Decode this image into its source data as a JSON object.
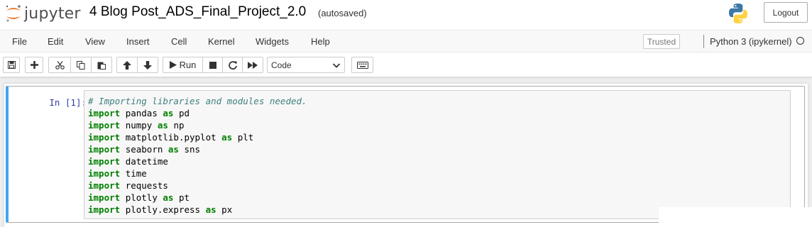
{
  "header": {
    "logo_text": "jupyter",
    "notebook_name": "4 Blog Post_ADS_Final_Project_2.0",
    "autosave_status": "(autosaved)",
    "logout_label": "Logout"
  },
  "menubar": {
    "items": [
      "File",
      "Edit",
      "View",
      "Insert",
      "Cell",
      "Kernel",
      "Widgets",
      "Help"
    ],
    "trusted_label": "Trusted",
    "kernel_name": "Python 3 (ipykernel)"
  },
  "toolbar": {
    "run_label": "Run",
    "cell_type": "Code",
    "icons": [
      "save-icon",
      "plus-icon",
      "cut-icon",
      "copy-icon",
      "paste-icon",
      "arrow-up-icon",
      "arrow-down-icon",
      "play-icon",
      "stop-icon",
      "restart-icon",
      "fast-forward-icon",
      "keyboard-icon"
    ]
  },
  "cell": {
    "prompt": "In [1]:",
    "comment": "# Importing libraries and modules needed.",
    "lines": [
      {
        "kw": "import",
        "mod": "pandas",
        "as": "as",
        "alias": "pd"
      },
      {
        "kw": "import",
        "mod": "numpy",
        "as": "as",
        "alias": "np"
      },
      {
        "kw": "import",
        "mod": "matplotlib.pyplot",
        "as": "as",
        "alias": "plt"
      },
      {
        "kw": "import",
        "mod": "seaborn",
        "as": "as",
        "alias": "sns"
      },
      {
        "kw": "import",
        "mod": "datetime"
      },
      {
        "kw": "import",
        "mod": "time"
      },
      {
        "kw": "import",
        "mod": "requests"
      },
      {
        "kw": "import",
        "mod": "plotly",
        "as": "as",
        "alias": "pt"
      },
      {
        "kw": "import",
        "mod": "plotly.express",
        "as": "as",
        "alias": "px"
      }
    ]
  },
  "colors": {
    "cell_selected_border": "#42a5f5",
    "prompt_color": "#303f9f",
    "keyword_color": "#008000",
    "comment_color": "#408080"
  }
}
